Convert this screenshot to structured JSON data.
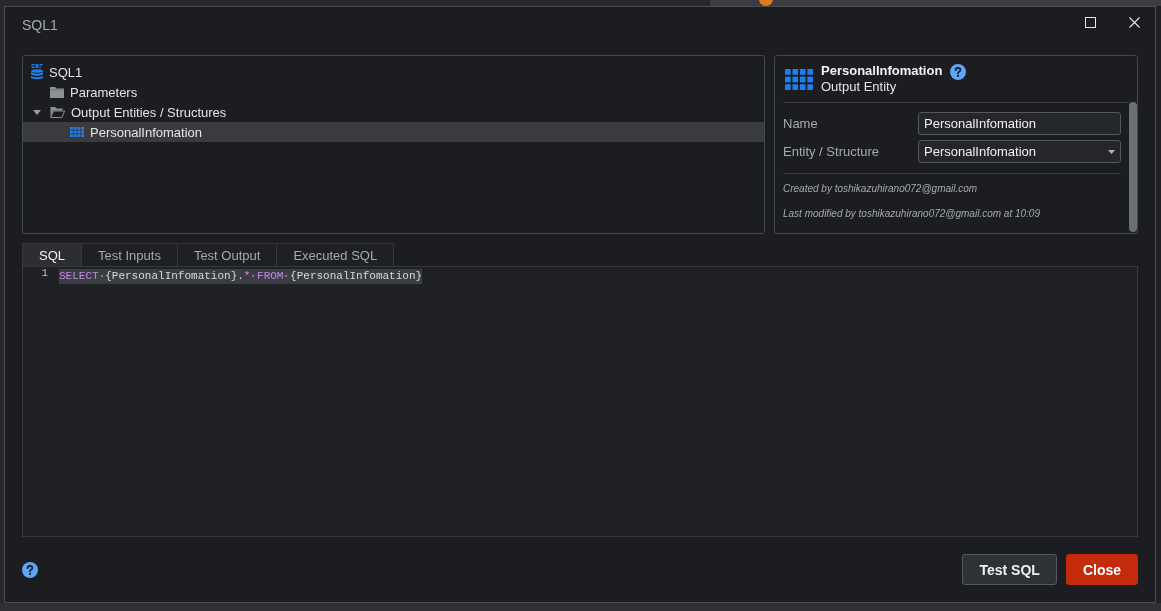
{
  "window": {
    "title": "SQL1"
  },
  "tree": [
    {
      "label": "SQL1",
      "kind": "sql",
      "selected": false,
      "children": [
        {
          "label": "Parameters",
          "kind": "folder",
          "expanded": false,
          "selected": false
        },
        {
          "label": "Output Entities / Structures",
          "kind": "folder",
          "expanded": true,
          "selected": false,
          "children": [
            {
              "label": "PersonalInfomation",
              "kind": "entity",
              "selected": true
            }
          ]
        }
      ]
    }
  ],
  "details": {
    "title": "PersonalInfomation",
    "subtitle": "Output Entity",
    "fields": [
      {
        "label": "Name",
        "kind": "text",
        "value": "PersonalInfomation"
      },
      {
        "label": "Entity / Structure",
        "kind": "select",
        "value": "PersonalInfomation"
      }
    ],
    "created": "Created by toshikazuhirano072@gmail.com",
    "modified": "Last modified by toshikazuhirano072@gmail.com at 10:09"
  },
  "tabs": [
    {
      "label": "SQL",
      "selected": true
    },
    {
      "label": "Test Inputs",
      "selected": false
    },
    {
      "label": "Test Output",
      "selected": false
    },
    {
      "label": "Executed SQL",
      "selected": false
    }
  ],
  "editor": {
    "lines": [
      {
        "number": "1",
        "selected": true,
        "tokens": [
          {
            "kind": "keyword",
            "text": "SELECT"
          },
          {
            "kind": "plain",
            "text": " {PersonalInfomation}."
          },
          {
            "kind": "operator",
            "text": "*"
          },
          {
            "kind": "keyword",
            "text": " FROM"
          },
          {
            "kind": "plain",
            "text": " {PersonalInfomation}"
          }
        ]
      }
    ]
  },
  "buttons": [
    {
      "label": "Test SQL",
      "kind": "secondary"
    },
    {
      "label": "Close",
      "kind": "primary"
    }
  ]
}
